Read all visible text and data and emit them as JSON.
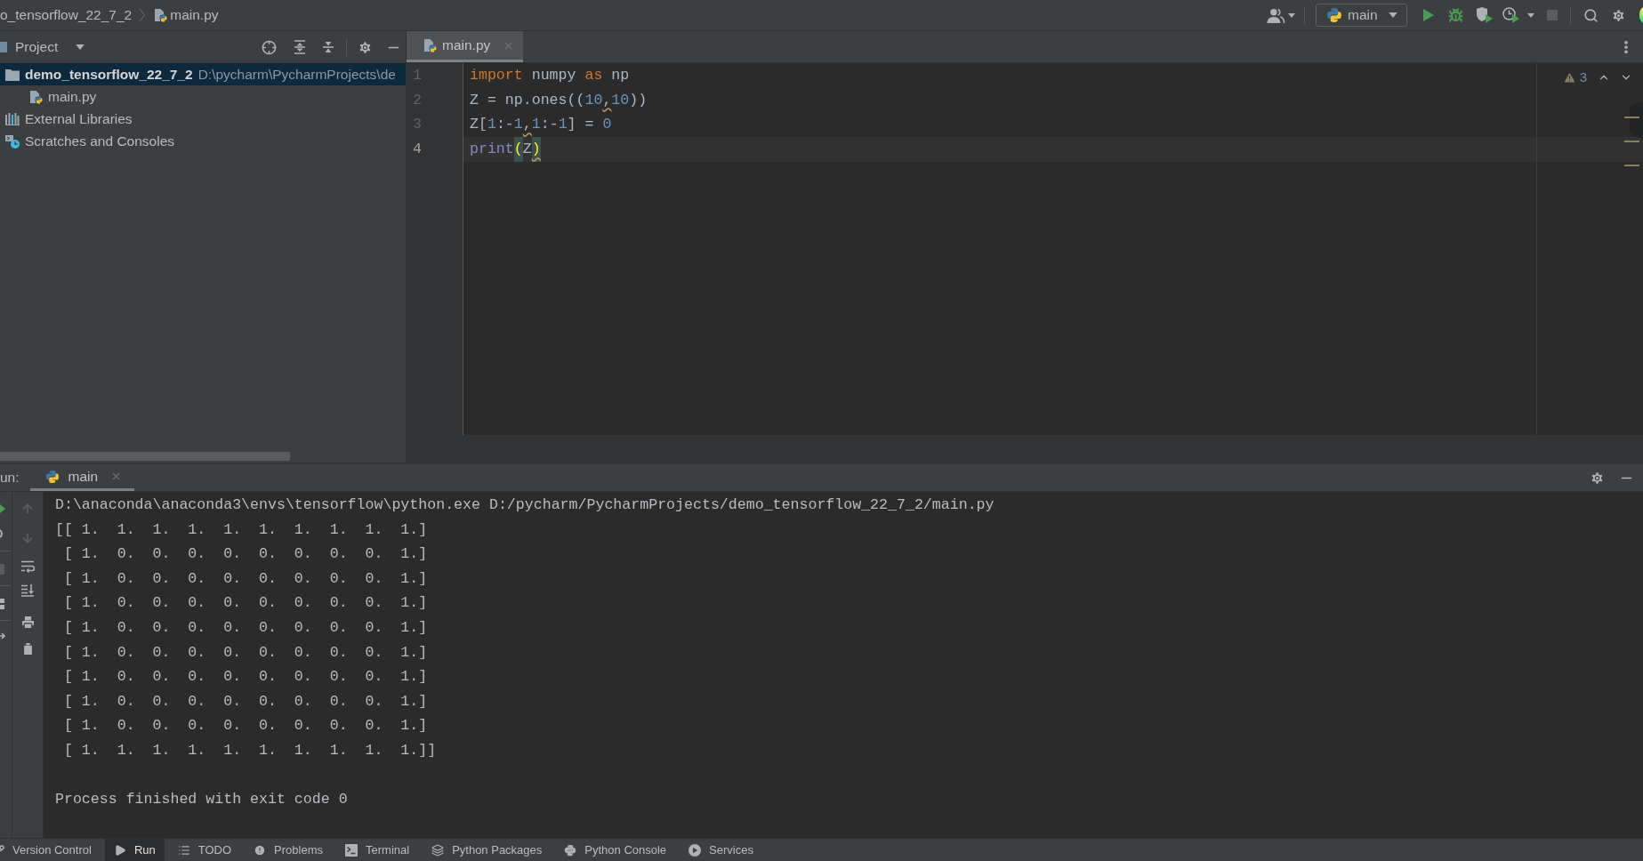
{
  "title_bar": {
    "breadcrumb": [
      {
        "label": "o_tensorflow_22_7_2",
        "kind": "folder"
      },
      {
        "label": "main.py",
        "kind": "python_file"
      }
    ],
    "run_configuration": "main"
  },
  "project_panel": {
    "title": "Project",
    "tree": [
      {
        "name": "demo_tensorflow_22_7_2",
        "path": "D:\\pycharm\\PycharmProjects\\de",
        "kind": "folder",
        "selected": true,
        "children": [
          {
            "name": "main.py",
            "kind": "python_file",
            "selected": false
          }
        ]
      },
      {
        "name": "External Libraries",
        "kind": "libraries",
        "selected": false
      },
      {
        "name": "Scratches and Consoles",
        "kind": "scratches",
        "selected": false
      }
    ]
  },
  "editor": {
    "tabs": [
      {
        "label": "main.py",
        "selected": true
      }
    ],
    "warning_count": "3",
    "lines": [
      {
        "number": "1",
        "current": false,
        "tokens": [
          {
            "text": "import",
            "kind": "keyword",
            "warning": false
          },
          {
            "text": " numpy ",
            "kind": "name",
            "warning": false
          },
          {
            "text": "as",
            "kind": "keyword",
            "warning": false
          },
          {
            "text": " np",
            "kind": "name",
            "warning": false
          }
        ]
      },
      {
        "number": "2",
        "current": false,
        "tokens": [
          {
            "text": "Z = np.ones((",
            "kind": "name",
            "warning": false
          },
          {
            "text": "10",
            "kind": "number",
            "warning": false
          },
          {
            "text": ",",
            "kind": "name",
            "warning": true
          },
          {
            "text": "10",
            "kind": "number",
            "warning": false
          },
          {
            "text": "))",
            "kind": "name",
            "warning": false
          }
        ]
      },
      {
        "number": "3",
        "current": false,
        "tokens": [
          {
            "text": "Z[",
            "kind": "name",
            "warning": false
          },
          {
            "text": "1",
            "kind": "number",
            "warning": false
          },
          {
            "text": ":-",
            "kind": "name",
            "warning": false
          },
          {
            "text": "1",
            "kind": "number",
            "warning": false
          },
          {
            "text": ",",
            "kind": "name",
            "warning": true
          },
          {
            "text": "1",
            "kind": "number",
            "warning": false
          },
          {
            "text": ":-",
            "kind": "name",
            "warning": false
          },
          {
            "text": "1",
            "kind": "number",
            "warning": false
          },
          {
            "text": "] = ",
            "kind": "name",
            "warning": false
          },
          {
            "text": "0",
            "kind": "number",
            "warning": false
          }
        ]
      },
      {
        "number": "4",
        "current": true,
        "tokens": [
          {
            "text": "print",
            "kind": "builtin",
            "warning": false
          },
          {
            "text": "(",
            "kind": "brace",
            "warning": false
          },
          {
            "text": "Z",
            "kind": "name",
            "warning": false
          },
          {
            "text": ")",
            "kind": "brace",
            "warning": true
          }
        ]
      }
    ]
  },
  "run_panel": {
    "label": "un:",
    "tabs": [
      {
        "label": "main",
        "selected": true
      }
    ],
    "output": [
      {
        "text": "D:\\anaconda\\anaconda3\\envs\\tensorflow\\python.exe D:/pycharm/PycharmProjects/demo_tensorflow_22_7_2/main.py",
        "kind": "command"
      },
      {
        "text": "[[ 1.  1.  1.  1.  1.  1.  1.  1.  1.  1.]",
        "kind": "stdout"
      },
      {
        "text": " [ 1.  0.  0.  0.  0.  0.  0.  0.  0.  1.]",
        "kind": "stdout"
      },
      {
        "text": " [ 1.  0.  0.  0.  0.  0.  0.  0.  0.  1.]",
        "kind": "stdout"
      },
      {
        "text": " [ 1.  0.  0.  0.  0.  0.  0.  0.  0.  1.]",
        "kind": "stdout"
      },
      {
        "text": " [ 1.  0.  0.  0.  0.  0.  0.  0.  0.  1.]",
        "kind": "stdout"
      },
      {
        "text": " [ 1.  0.  0.  0.  0.  0.  0.  0.  0.  1.]",
        "kind": "stdout"
      },
      {
        "text": " [ 1.  0.  0.  0.  0.  0.  0.  0.  0.  1.]",
        "kind": "stdout"
      },
      {
        "text": " [ 1.  0.  0.  0.  0.  0.  0.  0.  0.  1.]",
        "kind": "stdout"
      },
      {
        "text": " [ 1.  0.  0.  0.  0.  0.  0.  0.  0.  1.]",
        "kind": "stdout"
      },
      {
        "text": " [ 1.  1.  1.  1.  1.  1.  1.  1.  1.  1.]]",
        "kind": "stdout"
      },
      {
        "text": "Process finished with exit code 0",
        "kind": "exit"
      }
    ]
  },
  "status_bar": {
    "items": [
      {
        "label": "Version Control",
        "kind": "version_control",
        "selected": false
      },
      {
        "label": "Run",
        "kind": "run",
        "selected": true
      },
      {
        "label": "TODO",
        "kind": "todo",
        "selected": false
      },
      {
        "label": "Problems",
        "kind": "problems",
        "selected": false
      },
      {
        "label": "Terminal",
        "kind": "terminal",
        "selected": false
      },
      {
        "label": "Python Packages",
        "kind": "packages",
        "selected": false
      },
      {
        "label": "Python Console",
        "kind": "console",
        "selected": false
      },
      {
        "label": "Services",
        "kind": "services",
        "selected": false
      }
    ]
  }
}
